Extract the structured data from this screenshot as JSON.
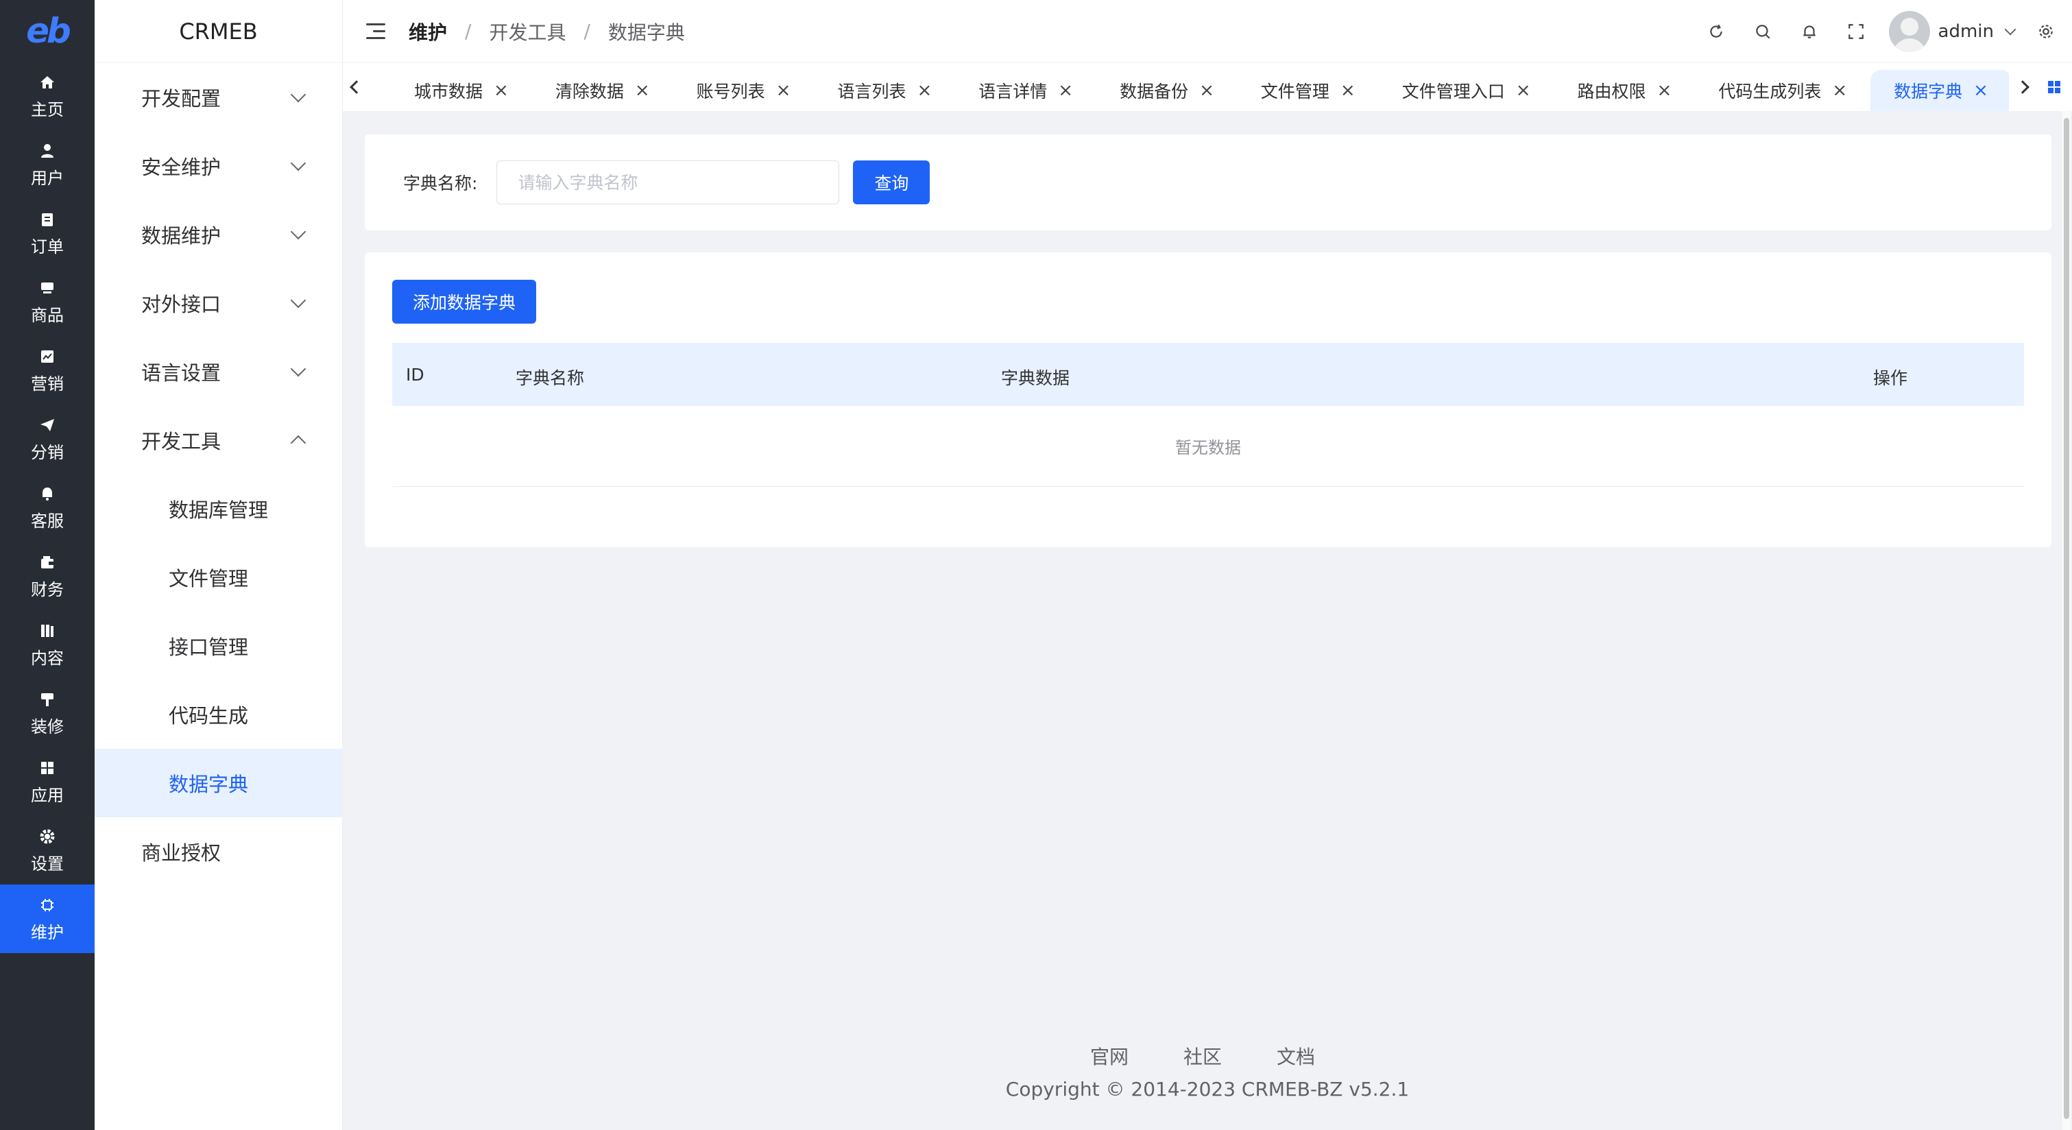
{
  "rail": {
    "logo": "eb",
    "items": [
      {
        "label": "主页",
        "icon": "home-icon"
      },
      {
        "label": "用户",
        "icon": "user-icon"
      },
      {
        "label": "订单",
        "icon": "order-icon"
      },
      {
        "label": "商品",
        "icon": "product-icon"
      },
      {
        "label": "营销",
        "icon": "marketing-icon"
      },
      {
        "label": "分销",
        "icon": "distribution-icon"
      },
      {
        "label": "客服",
        "icon": "customer-service-icon"
      },
      {
        "label": "财务",
        "icon": "finance-icon"
      },
      {
        "label": "内容",
        "icon": "content-icon"
      },
      {
        "label": "装修",
        "icon": "decoration-icon"
      },
      {
        "label": "应用",
        "icon": "apps-icon"
      },
      {
        "label": "设置",
        "icon": "settings-icon"
      },
      {
        "label": "维护",
        "icon": "maintenance-icon"
      }
    ],
    "active_index": 12
  },
  "submenu": {
    "brand": "CRMEB",
    "groups": [
      {
        "label": "开发配置",
        "expanded": false
      },
      {
        "label": "安全维护",
        "expanded": false
      },
      {
        "label": "数据维护",
        "expanded": false
      },
      {
        "label": "对外接口",
        "expanded": false
      },
      {
        "label": "语言设置",
        "expanded": false
      },
      {
        "label": "开发工具",
        "expanded": true
      }
    ],
    "dev_tools_items": [
      "数据库管理",
      "文件管理",
      "接口管理",
      "代码生成",
      "数据字典"
    ],
    "active_item": "数据字典",
    "bottom_item": "商业授权"
  },
  "header": {
    "breadcrumb": [
      "维护",
      "开发工具",
      "数据字典"
    ],
    "separator": "/",
    "username": "admin",
    "icons": [
      "refresh-icon",
      "search-icon",
      "bell-icon",
      "fullscreen-icon",
      "settings-gear-icon"
    ]
  },
  "tabs": {
    "items": [
      "城市数据",
      "清除数据",
      "账号列表",
      "语言列表",
      "语言详情",
      "数据备份",
      "文件管理",
      "文件管理入口",
      "路由权限",
      "代码生成列表",
      "数据字典"
    ],
    "active_index": 10,
    "close_glyph": "×"
  },
  "search": {
    "label": "字典名称:",
    "placeholder": "请输入字典名称",
    "value": "",
    "button": "查询"
  },
  "table": {
    "add_button": "添加数据字典",
    "columns": [
      "ID",
      "字典名称",
      "字典数据",
      "操作"
    ],
    "empty_text": "暂无数据"
  },
  "footer": {
    "links": [
      "官网",
      "社区",
      "文档"
    ],
    "copyright": "Copyright © 2014-2023 CRMEB-BZ v5.2.1"
  },
  "colors": {
    "primary": "#1e63f5",
    "rail_bg": "#282c34",
    "active_bg": "#e8f1ff",
    "page_bg": "#f0f2f5"
  }
}
